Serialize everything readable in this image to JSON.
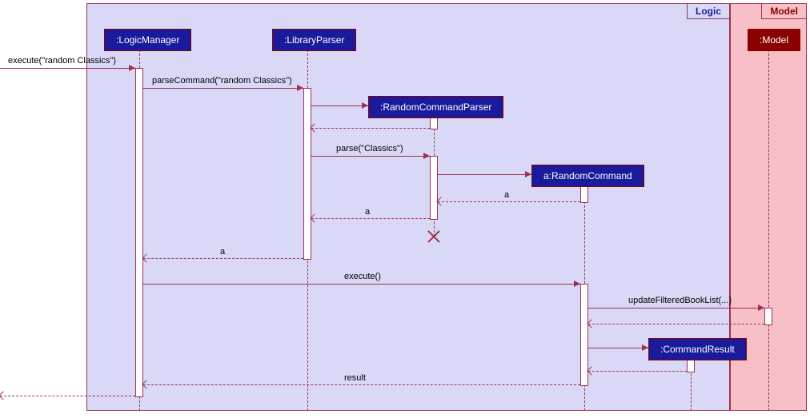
{
  "frames": {
    "logic": {
      "label": "Logic"
    },
    "model": {
      "label": "Model"
    }
  },
  "participants": {
    "logicManager": ":LogicManager",
    "libraryParser": ":LibraryParser",
    "randomCommandParser": ":RandomCommandParser",
    "randomCommand": "a:RandomCommand",
    "model": ":Model",
    "commandResult": ":CommandResult"
  },
  "messages": {
    "m1": "execute(\"random Classics\")",
    "m2": "parseCommand(\"random Classics\")",
    "m3": "parse(\"Classics\")",
    "m4": "a",
    "m5": "a",
    "m6": "a",
    "m7": "execute()",
    "m8": "updateFilteredBookList(...)",
    "m9": "result"
  },
  "chart_data": {
    "type": "sequence-diagram",
    "frames": [
      {
        "name": "Logic",
        "contains": [
          "LogicManager",
          "LibraryParser",
          "RandomCommandParser",
          "RandomCommand",
          "CommandResult"
        ]
      },
      {
        "name": "Model",
        "contains": [
          "Model"
        ]
      }
    ],
    "participants": [
      {
        "id": "lm",
        "name": ":LogicManager"
      },
      {
        "id": "lp",
        "name": ":LibraryParser"
      },
      {
        "id": "rcp",
        "name": ":RandomCommandParser",
        "created": true,
        "destroyed": true
      },
      {
        "id": "rc",
        "name": "a:RandomCommand",
        "created": true
      },
      {
        "id": "md",
        "name": ":Model"
      },
      {
        "id": "cr",
        "name": ":CommandResult",
        "created": true
      }
    ],
    "messages": [
      {
        "from": "external",
        "to": "lm",
        "label": "execute(\"random Classics\")",
        "type": "sync"
      },
      {
        "from": "lm",
        "to": "lp",
        "label": "parseCommand(\"random Classics\")",
        "type": "sync"
      },
      {
        "from": "lp",
        "to": "rcp",
        "label": "",
        "type": "create"
      },
      {
        "from": "rcp",
        "to": "lp",
        "label": "",
        "type": "return"
      },
      {
        "from": "lp",
        "to": "rcp",
        "label": "parse(\"Classics\")",
        "type": "sync"
      },
      {
        "from": "rcp",
        "to": "rc",
        "label": "",
        "type": "create"
      },
      {
        "from": "rc",
        "to": "rcp",
        "label": "a",
        "type": "return"
      },
      {
        "from": "rcp",
        "to": "lp",
        "label": "a",
        "type": "return"
      },
      {
        "from": "rcp",
        "to": null,
        "label": "",
        "type": "destroy"
      },
      {
        "from": "lp",
        "to": "lm",
        "label": "a",
        "type": "return"
      },
      {
        "from": "lm",
        "to": "rc",
        "label": "execute()",
        "type": "sync"
      },
      {
        "from": "rc",
        "to": "md",
        "label": "updateFilteredBookList(...)",
        "type": "sync"
      },
      {
        "from": "md",
        "to": "rc",
        "label": "",
        "type": "return"
      },
      {
        "from": "rc",
        "to": "cr",
        "label": "",
        "type": "create"
      },
      {
        "from": "cr",
        "to": "rc",
        "label": "",
        "type": "return"
      },
      {
        "from": "rc",
        "to": "lm",
        "label": "result",
        "type": "return"
      },
      {
        "from": "lm",
        "to": "external",
        "label": "",
        "type": "return"
      }
    ]
  }
}
